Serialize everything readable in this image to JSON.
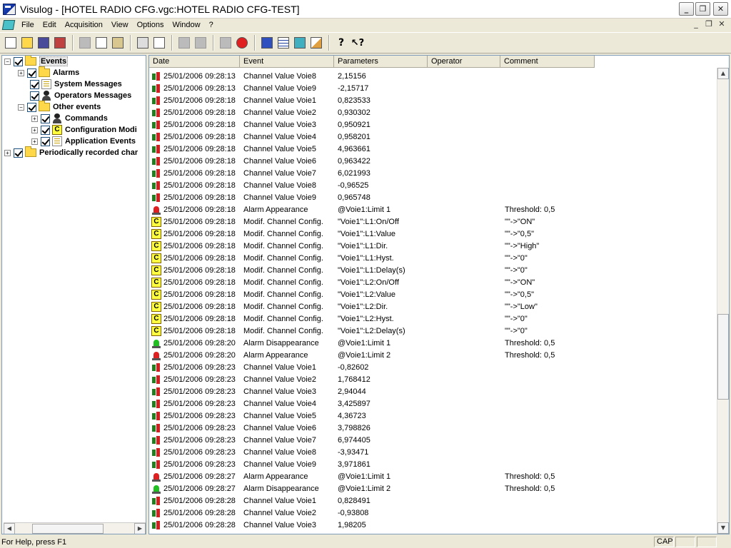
{
  "window": {
    "title": "Visulog - [HOTEL RADIO CFG.vgc:HOTEL RADIO CFG-TEST]",
    "controls": [
      "_",
      "❐",
      "✕"
    ]
  },
  "menu": {
    "items": [
      "File",
      "Edit",
      "Acquisition",
      "View",
      "Options",
      "Window",
      "?"
    ],
    "mdi_controls": [
      "_",
      "❐",
      "✕"
    ]
  },
  "toolbar": {
    "tools": [
      "new-icon",
      "open-icon",
      "save-icon",
      "close-file-icon",
      "cut-icon",
      "copy-icon",
      "paste-icon",
      "print-icon",
      "print-preview-icon",
      "monitor-icon",
      "monitor2-icon",
      "acquisition-icon",
      "stop-icon",
      "book-icon",
      "table-icon",
      "export-icon",
      "chart-icon",
      "help-icon",
      "context-help-icon"
    ]
  },
  "tree": {
    "items": [
      {
        "label": "Events",
        "level": 0,
        "expander": "-",
        "icon": "folder"
      },
      {
        "label": "Alarms",
        "level": 1,
        "expander": "+",
        "icon": "folder"
      },
      {
        "label": "System Messages",
        "level": 1,
        "expander": "",
        "icon": "sys"
      },
      {
        "label": "Operators Messages",
        "level": 1,
        "expander": "",
        "icon": "user"
      },
      {
        "label": "Other events",
        "level": 1,
        "expander": "-",
        "icon": "folder"
      },
      {
        "label": "Commands",
        "level": 2,
        "expander": "+",
        "icon": "user"
      },
      {
        "label": "Configuration Modi",
        "level": 2,
        "expander": "+",
        "icon": "config"
      },
      {
        "label": "Application Events",
        "level": 2,
        "expander": "+",
        "icon": "sys"
      },
      {
        "label": "Periodically recorded char",
        "level": 0,
        "expander": "+",
        "icon": "folder"
      }
    ]
  },
  "table": {
    "headers": [
      "Date",
      "Event",
      "Parameters",
      "Operator",
      "Comment"
    ],
    "rows": [
      {
        "type": "chan",
        "date": "25/01/2006 09:28:13",
        "event": "Channel Value Voie8",
        "param": " 2,15156",
        "operator": "",
        "comment": ""
      },
      {
        "type": "chan",
        "date": "25/01/2006 09:28:13",
        "event": "Channel Value Voie9",
        "param": "-2,15717",
        "operator": "",
        "comment": ""
      },
      {
        "type": "chan",
        "date": "25/01/2006 09:28:18",
        "event": "Channel Value Voie1",
        "param": "0,823533",
        "operator": "",
        "comment": ""
      },
      {
        "type": "chan",
        "date": "25/01/2006 09:28:18",
        "event": "Channel Value Voie2",
        "param": "0,930302",
        "operator": "",
        "comment": ""
      },
      {
        "type": "chan",
        "date": "25/01/2006 09:28:18",
        "event": "Channel Value Voie3",
        "param": "0,950921",
        "operator": "",
        "comment": ""
      },
      {
        "type": "chan",
        "date": "25/01/2006 09:28:18",
        "event": "Channel Value Voie4",
        "param": "0,958201",
        "operator": "",
        "comment": ""
      },
      {
        "type": "chan",
        "date": "25/01/2006 09:28:18",
        "event": "Channel Value Voie5",
        "param": "4,963661",
        "operator": "",
        "comment": ""
      },
      {
        "type": "chan",
        "date": "25/01/2006 09:28:18",
        "event": "Channel Value Voie6",
        "param": "0,963422",
        "operator": "",
        "comment": ""
      },
      {
        "type": "chan",
        "date": "25/01/2006 09:28:18",
        "event": "Channel Value Voie7",
        "param": "6,021993",
        "operator": "",
        "comment": ""
      },
      {
        "type": "chan",
        "date": "25/01/2006 09:28:18",
        "event": "Channel Value Voie8",
        "param": "-0,96525",
        "operator": "",
        "comment": ""
      },
      {
        "type": "chan",
        "date": "25/01/2006 09:28:18",
        "event": "Channel Value Voie9",
        "param": "0,965748",
        "operator": "",
        "comment": ""
      },
      {
        "type": "alarm-red",
        "date": "25/01/2006 09:28:18",
        "event": "Alarm Appearance",
        "param": "@Voie1:Limit 1",
        "operator": "",
        "comment": "Threshold: 0,5"
      },
      {
        "type": "config",
        "date": "25/01/2006 09:28:18",
        "event": "Modif. Channel Config.",
        "param": "\"Voie1\":L1:On/Off",
        "operator": "",
        "comment": "\"\"->\"ON\""
      },
      {
        "type": "config",
        "date": "25/01/2006 09:28:18",
        "event": "Modif. Channel Config.",
        "param": "\"Voie1\":L1:Value",
        "operator": "",
        "comment": "\"\"->\"0,5\""
      },
      {
        "type": "config",
        "date": "25/01/2006 09:28:18",
        "event": "Modif. Channel Config.",
        "param": "\"Voie1\":L1:Dir.",
        "operator": "",
        "comment": "\"\"->\"High\""
      },
      {
        "type": "config",
        "date": "25/01/2006 09:28:18",
        "event": "Modif. Channel Config.",
        "param": "\"Voie1\":L1:Hyst.",
        "operator": "",
        "comment": "\"\"->\"0\""
      },
      {
        "type": "config",
        "date": "25/01/2006 09:28:18",
        "event": "Modif. Channel Config.",
        "param": "\"Voie1\":L1:Delay(s)",
        "operator": "",
        "comment": "\"\"->\"0\""
      },
      {
        "type": "config",
        "date": "25/01/2006 09:28:18",
        "event": "Modif. Channel Config.",
        "param": "\"Voie1\":L2:On/Off",
        "operator": "",
        "comment": "\"\"->\"ON\""
      },
      {
        "type": "config",
        "date": "25/01/2006 09:28:18",
        "event": "Modif. Channel Config.",
        "param": "\"Voie1\":L2:Value",
        "operator": "",
        "comment": "\"\"->\"0,5\""
      },
      {
        "type": "config",
        "date": "25/01/2006 09:28:18",
        "event": "Modif. Channel Config.",
        "param": "\"Voie1\":L2:Dir.",
        "operator": "",
        "comment": "\"\"->\"Low\""
      },
      {
        "type": "config",
        "date": "25/01/2006 09:28:18",
        "event": "Modif. Channel Config.",
        "param": "\"Voie1\":L2:Hyst.",
        "operator": "",
        "comment": "\"\"->\"0\""
      },
      {
        "type": "config",
        "date": "25/01/2006 09:28:18",
        "event": "Modif. Channel Config.",
        "param": "\"Voie1\":L2:Delay(s)",
        "operator": "",
        "comment": "\"\"->\"0\""
      },
      {
        "type": "alarm-green",
        "date": "25/01/2006 09:28:20",
        "event": "Alarm Disappearance",
        "param": "@Voie1:Limit 1",
        "operator": "",
        "comment": "Threshold: 0,5"
      },
      {
        "type": "alarm-red",
        "date": "25/01/2006 09:28:20",
        "event": "Alarm Appearance",
        "param": "@Voie1:Limit 2",
        "operator": "",
        "comment": "Threshold: 0,5"
      },
      {
        "type": "chan",
        "date": "25/01/2006 09:28:23",
        "event": "Channel Value Voie1",
        "param": "-0,82602",
        "operator": "",
        "comment": ""
      },
      {
        "type": "chan",
        "date": "25/01/2006 09:28:23",
        "event": "Channel Value Voie2",
        "param": "1,768412",
        "operator": "",
        "comment": ""
      },
      {
        "type": "chan",
        "date": "25/01/2006 09:28:23",
        "event": "Channel Value Voie3",
        "param": " 2,94044",
        "operator": "",
        "comment": ""
      },
      {
        "type": "chan",
        "date": "25/01/2006 09:28:23",
        "event": "Channel Value Voie4",
        "param": "3,425897",
        "operator": "",
        "comment": ""
      },
      {
        "type": "chan",
        "date": "25/01/2006 09:28:23",
        "event": "Channel Value Voie5",
        "param": " 4,36723",
        "operator": "",
        "comment": ""
      },
      {
        "type": "chan",
        "date": "25/01/2006 09:28:23",
        "event": "Channel Value Voie6",
        "param": "3,798826",
        "operator": "",
        "comment": ""
      },
      {
        "type": "chan",
        "date": "25/01/2006 09:28:23",
        "event": "Channel Value Voie7",
        "param": "6,974405",
        "operator": "",
        "comment": ""
      },
      {
        "type": "chan",
        "date": "25/01/2006 09:28:23",
        "event": "Channel Value Voie8",
        "param": "-3,93471",
        "operator": "",
        "comment": ""
      },
      {
        "type": "chan",
        "date": "25/01/2006 09:28:23",
        "event": "Channel Value Voie9",
        "param": "3,971861",
        "operator": "",
        "comment": ""
      },
      {
        "type": "alarm-red",
        "date": "25/01/2006 09:28:27",
        "event": "Alarm Appearance",
        "param": "@Voie1:Limit 1",
        "operator": "",
        "comment": "Threshold: 0,5"
      },
      {
        "type": "alarm-green",
        "date": "25/01/2006 09:28:27",
        "event": "Alarm Disappearance",
        "param": "@Voie1:Limit 2",
        "operator": "",
        "comment": "Threshold: 0,5"
      },
      {
        "type": "chan",
        "date": "25/01/2006 09:28:28",
        "event": "Channel Value Voie1",
        "param": "0,828491",
        "operator": "",
        "comment": ""
      },
      {
        "type": "chan",
        "date": "25/01/2006 09:28:28",
        "event": "Channel Value Voie2",
        "param": "-0,93808",
        "operator": "",
        "comment": ""
      },
      {
        "type": "chan",
        "date": "25/01/2006 09:28:28",
        "event": "Channel Value Voie3",
        "param": " 1,98205",
        "operator": "",
        "comment": ""
      }
    ]
  },
  "statusbar": {
    "text": "For Help, press F1",
    "caps": "CAP"
  }
}
